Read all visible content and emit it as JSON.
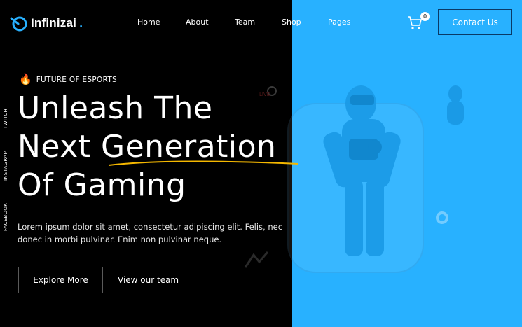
{
  "brand": {
    "name": "Infinizai",
    "dot": ".",
    "accent": "#28b1ff"
  },
  "nav": {
    "items": [
      {
        "label": "Home"
      },
      {
        "label": "About"
      },
      {
        "label": "Team"
      },
      {
        "label": "Shop"
      },
      {
        "label": "Pages"
      }
    ]
  },
  "cart": {
    "icon": "cart-icon",
    "count": "0"
  },
  "contact_button": "Contact Us",
  "social": [
    "TWITCH",
    "INSTAGRAM",
    "FACEBOOK"
  ],
  "hero": {
    "eyebrow_icon": "fire-icon",
    "eyebrow": "FUTURE OF ESPORTS",
    "line1": "Unleash The",
    "line2": "Next Generation",
    "line3": "Of Gaming",
    "description": "Lorem ipsum dolor sit amet, consectetur adipiscing elit. Felis, nec donec in morbi pulvinar. Enim non pulvinar neque.",
    "primary_button": "Explore More",
    "secondary_link": "View our team"
  },
  "colors": {
    "background": "#000000",
    "panel": "#28b1ff",
    "underline": "#f5b800"
  }
}
